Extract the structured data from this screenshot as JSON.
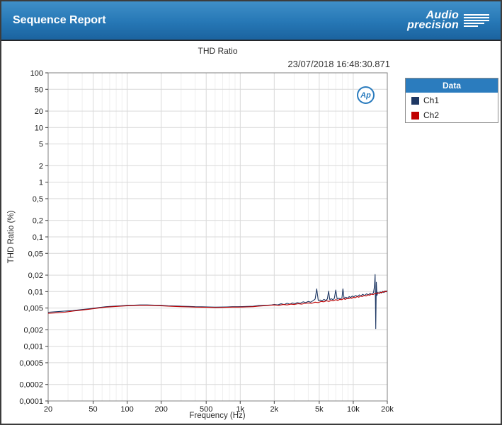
{
  "header": {
    "title": "Sequence Report",
    "logo_line1": "Audio",
    "logo_line2": "precision"
  },
  "report": {
    "chart_title": "THD Ratio",
    "timestamp": "23/07/2018 16:48:30.871",
    "ap_badge": "Ap"
  },
  "legend": {
    "header": "Data",
    "items": [
      {
        "label": "Ch1",
        "color": "#1f3864"
      },
      {
        "label": "Ch2",
        "color": "#c00000"
      }
    ]
  },
  "colors": {
    "header_blue": "#2b7cbe",
    "grid_major": "#d9d9d9",
    "grid_minor": "#efefef",
    "plot_border": "#808080"
  },
  "chart_data": {
    "type": "line",
    "title": "THD Ratio",
    "xlabel": "Frequency (Hz)",
    "ylabel": "THD Ratio (%)",
    "x_scale": "log",
    "y_scale": "log",
    "xlim": [
      20,
      20000
    ],
    "ylim": [
      0.0001,
      100
    ],
    "grid": true,
    "legend_position": "right",
    "x_ticks": [
      {
        "v": 20,
        "label": "20"
      },
      {
        "v": 50,
        "label": "50"
      },
      {
        "v": 100,
        "label": "100"
      },
      {
        "v": 200,
        "label": "200"
      },
      {
        "v": 500,
        "label": "500"
      },
      {
        "v": 1000,
        "label": "1k"
      },
      {
        "v": 2000,
        "label": "2k"
      },
      {
        "v": 5000,
        "label": "5k"
      },
      {
        "v": 10000,
        "label": "10k"
      },
      {
        "v": 20000,
        "label": "20k"
      }
    ],
    "y_ticks": [
      {
        "v": 100,
        "label": "100"
      },
      {
        "v": 50,
        "label": "50"
      },
      {
        "v": 20,
        "label": "20"
      },
      {
        "v": 10,
        "label": "10"
      },
      {
        "v": 5,
        "label": "5"
      },
      {
        "v": 2,
        "label": "2"
      },
      {
        "v": 1,
        "label": "1"
      },
      {
        "v": 0.5,
        "label": "0,5"
      },
      {
        "v": 0.2,
        "label": "0,2"
      },
      {
        "v": 0.1,
        "label": "0,1"
      },
      {
        "v": 0.05,
        "label": "0,05"
      },
      {
        "v": 0.02,
        "label": "0,02"
      },
      {
        "v": 0.01,
        "label": "0,01"
      },
      {
        "v": 0.005,
        "label": "0,005"
      },
      {
        "v": 0.002,
        "label": "0,002"
      },
      {
        "v": 0.001,
        "label": "0,001"
      },
      {
        "v": 0.0005,
        "label": "0,0005"
      },
      {
        "v": 0.0002,
        "label": "0,0002"
      },
      {
        "v": 0.0001,
        "label": "0,0001"
      }
    ],
    "series": [
      {
        "name": "Ch1",
        "color": "#1f3864",
        "points": [
          [
            20,
            0.0042
          ],
          [
            24,
            0.0043
          ],
          [
            28,
            0.0044
          ],
          [
            33,
            0.0045
          ],
          [
            40,
            0.0047
          ],
          [
            48,
            0.0049
          ],
          [
            56,
            0.0051
          ],
          [
            65,
            0.0053
          ],
          [
            75,
            0.0054
          ],
          [
            88,
            0.0055
          ],
          [
            100,
            0.0056
          ],
          [
            115,
            0.00565
          ],
          [
            130,
            0.0057
          ],
          [
            150,
            0.0057
          ],
          [
            175,
            0.00565
          ],
          [
            200,
            0.0056
          ],
          [
            230,
            0.0055
          ],
          [
            260,
            0.00545
          ],
          [
            300,
            0.0054
          ],
          [
            350,
            0.00535
          ],
          [
            400,
            0.0053
          ],
          [
            460,
            0.00528
          ],
          [
            520,
            0.00525
          ],
          [
            600,
            0.0052
          ],
          [
            680,
            0.00522
          ],
          [
            760,
            0.00525
          ],
          [
            850,
            0.0053
          ],
          [
            950,
            0.0053
          ],
          [
            1050,
            0.00532
          ],
          [
            1150,
            0.00535
          ],
          [
            1300,
            0.0054
          ],
          [
            1450,
            0.00555
          ],
          [
            1600,
            0.0056
          ],
          [
            1750,
            0.00565
          ],
          [
            1900,
            0.0057
          ],
          [
            2000,
            0.0058
          ],
          [
            2150,
            0.0057
          ],
          [
            2300,
            0.006
          ],
          [
            2450,
            0.0058
          ],
          [
            2600,
            0.0061
          ],
          [
            2750,
            0.0059
          ],
          [
            2900,
            0.0062
          ],
          [
            3050,
            0.006
          ],
          [
            3200,
            0.0063
          ],
          [
            3400,
            0.0061
          ],
          [
            3600,
            0.0065
          ],
          [
            3800,
            0.0063
          ],
          [
            4000,
            0.0066
          ],
          [
            4200,
            0.0064
          ],
          [
            4400,
            0.0068
          ],
          [
            4600,
            0.0073
          ],
          [
            4750,
            0.0112
          ],
          [
            4900,
            0.0069
          ],
          [
            5100,
            0.007
          ],
          [
            5300,
            0.0068
          ],
          [
            5500,
            0.0072
          ],
          [
            5700,
            0.0069
          ],
          [
            5900,
            0.0073
          ],
          [
            6050,
            0.0102
          ],
          [
            6200,
            0.0071
          ],
          [
            6400,
            0.0074
          ],
          [
            6600,
            0.0071
          ],
          [
            6800,
            0.0075
          ],
          [
            7000,
            0.0107
          ],
          [
            7200,
            0.0073
          ],
          [
            7450,
            0.0076
          ],
          [
            7700,
            0.0073
          ],
          [
            7950,
            0.0077
          ],
          [
            8100,
            0.0112
          ],
          [
            8300,
            0.0075
          ],
          [
            8600,
            0.0079
          ],
          [
            8900,
            0.0076
          ],
          [
            9200,
            0.0081
          ],
          [
            9500,
            0.0078
          ],
          [
            9800,
            0.0083
          ],
          [
            10100,
            0.008
          ],
          [
            10500,
            0.0085
          ],
          [
            10900,
            0.0081
          ],
          [
            11300,
            0.0087
          ],
          [
            11700,
            0.0083
          ],
          [
            12100,
            0.0089
          ],
          [
            12600,
            0.0085
          ],
          [
            13100,
            0.0091
          ],
          [
            13600,
            0.0087
          ],
          [
            14100,
            0.0093
          ],
          [
            14600,
            0.0089
          ],
          [
            15100,
            0.0096
          ],
          [
            15400,
            0.0125
          ],
          [
            15600,
            0.0205
          ],
          [
            15800,
            0.0021
          ],
          [
            16000,
            0.0148
          ],
          [
            16200,
            0.0085
          ],
          [
            16500,
            0.0097
          ],
          [
            16900,
            0.0092
          ],
          [
            17300,
            0.0099
          ],
          [
            17700,
            0.0094
          ],
          [
            18100,
            0.0101
          ],
          [
            18600,
            0.0096
          ],
          [
            19100,
            0.0103
          ],
          [
            19500,
            0.0099
          ],
          [
            20000,
            0.0105
          ]
        ]
      },
      {
        "name": "Ch2",
        "color": "#c00000",
        "points": [
          [
            20,
            0.004
          ],
          [
            24,
            0.0041
          ],
          [
            28,
            0.0042
          ],
          [
            33,
            0.0044
          ],
          [
            40,
            0.0046
          ],
          [
            48,
            0.0048
          ],
          [
            56,
            0.005
          ],
          [
            65,
            0.0052
          ],
          [
            75,
            0.0053
          ],
          [
            88,
            0.0054
          ],
          [
            100,
            0.0055
          ],
          [
            115,
            0.00555
          ],
          [
            130,
            0.0056
          ],
          [
            150,
            0.0056
          ],
          [
            175,
            0.00555
          ],
          [
            200,
            0.0055
          ],
          [
            230,
            0.0054
          ],
          [
            260,
            0.00535
          ],
          [
            300,
            0.0053
          ],
          [
            350,
            0.00525
          ],
          [
            400,
            0.0052
          ],
          [
            460,
            0.00518
          ],
          [
            520,
            0.00515
          ],
          [
            600,
            0.0051
          ],
          [
            680,
            0.00512
          ],
          [
            760,
            0.00515
          ],
          [
            850,
            0.0052
          ],
          [
            950,
            0.0052
          ],
          [
            1050,
            0.00522
          ],
          [
            1150,
            0.00525
          ],
          [
            1300,
            0.0053
          ],
          [
            1450,
            0.0054
          ],
          [
            1600,
            0.0055
          ],
          [
            1800,
            0.0056
          ],
          [
            2000,
            0.0057
          ],
          [
            2200,
            0.0056
          ],
          [
            2400,
            0.0058
          ],
          [
            2600,
            0.0057
          ],
          [
            2800,
            0.0059
          ],
          [
            3000,
            0.0058
          ],
          [
            3250,
            0.006
          ],
          [
            3500,
            0.0059
          ],
          [
            3750,
            0.0061
          ],
          [
            4000,
            0.0062
          ],
          [
            4300,
            0.0061
          ],
          [
            4600,
            0.0064
          ],
          [
            4900,
            0.0063
          ],
          [
            5200,
            0.0066
          ],
          [
            5500,
            0.0065
          ],
          [
            5800,
            0.0068
          ],
          [
            6100,
            0.0066
          ],
          [
            6400,
            0.0069
          ],
          [
            6700,
            0.0068
          ],
          [
            7000,
            0.0071
          ],
          [
            7300,
            0.0069
          ],
          [
            7600,
            0.0072
          ],
          [
            7900,
            0.0071
          ],
          [
            8200,
            0.0074
          ],
          [
            8500,
            0.0072
          ],
          [
            8800,
            0.0075
          ],
          [
            9100,
            0.0074
          ],
          [
            9400,
            0.0077
          ],
          [
            9700,
            0.0075
          ],
          [
            10000,
            0.0079
          ],
          [
            10400,
            0.0077
          ],
          [
            10800,
            0.0081
          ],
          [
            11200,
            0.0079
          ],
          [
            11600,
            0.0083
          ],
          [
            12000,
            0.0081
          ],
          [
            12500,
            0.0085
          ],
          [
            13000,
            0.0083
          ],
          [
            13500,
            0.0087
          ],
          [
            14000,
            0.0086
          ],
          [
            14500,
            0.009
          ],
          [
            15000,
            0.0088
          ],
          [
            15500,
            0.0092
          ],
          [
            16000,
            0.0091
          ],
          [
            16500,
            0.0095
          ],
          [
            17000,
            0.0093
          ],
          [
            17500,
            0.0097
          ],
          [
            18000,
            0.0096
          ],
          [
            18500,
            0.01
          ],
          [
            19000,
            0.0098
          ],
          [
            19500,
            0.0102
          ],
          [
            20000,
            0.01
          ]
        ]
      }
    ]
  }
}
